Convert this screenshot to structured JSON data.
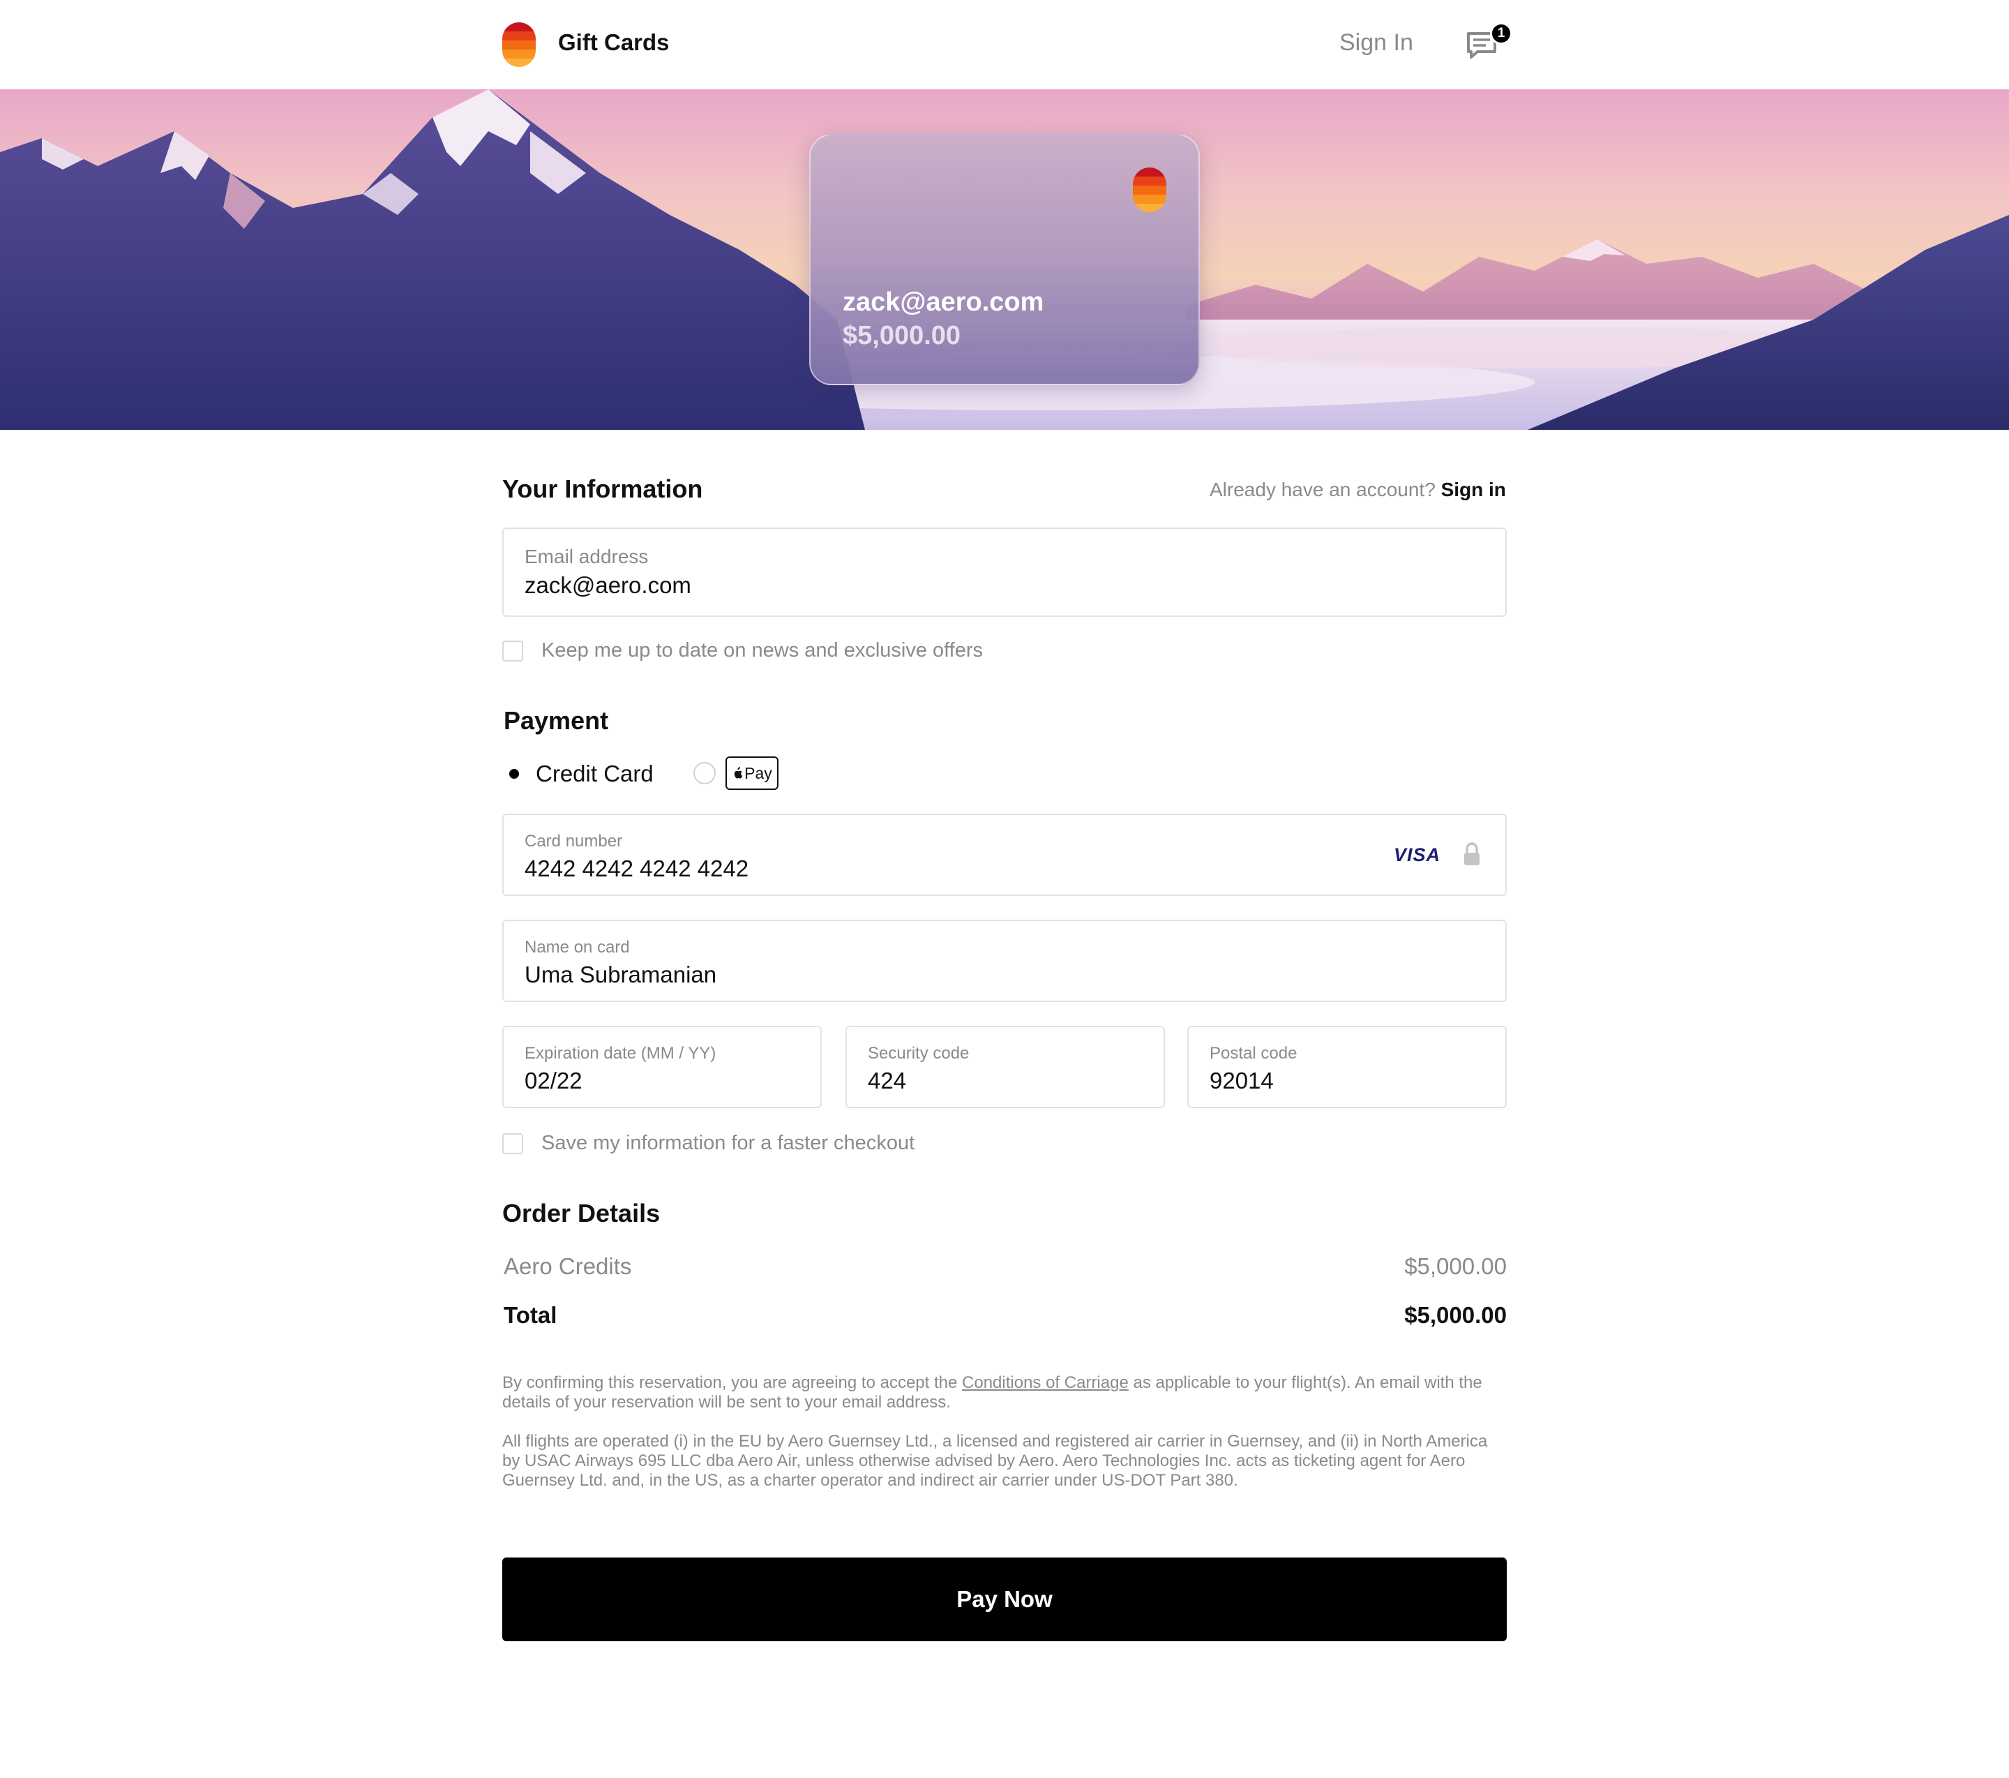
{
  "header": {
    "brand": "Gift Cards",
    "sign_in": "Sign In",
    "messages_icon": "chat-icon",
    "notification_count": "1"
  },
  "gift_card": {
    "email": "zack@aero.com",
    "amount": "$5,000.00"
  },
  "your_information": {
    "title": "Your Information",
    "account_prompt": "Already have an account?",
    "sign_in_link": "Sign in",
    "email_label": "Email address",
    "email_value": "zack@aero.com",
    "newsletter_label": "Keep me up to date on news and exclusive offers"
  },
  "payment": {
    "title": "Payment",
    "method_credit": "Credit Card",
    "method_applepay": "Pay",
    "selected": "Credit Card",
    "card_number_label": "Card number",
    "card_number_value": "4242 4242 4242 4242",
    "card_brand": "VISA",
    "name_label": "Name on card",
    "name_value": "Uma Subramanian",
    "expiry_label": "Expiration date (MM / YY)",
    "expiry_value": "02/22",
    "security_label": "Security code",
    "security_value": "424",
    "postal_label": "Postal code",
    "postal_value": "92014",
    "save_label": "Save my information for a faster checkout"
  },
  "order": {
    "title": "Order Details",
    "item_label": "Aero Credits",
    "item_price": "$5,000.00",
    "total_label": "Total",
    "total_price": "$5,000.00"
  },
  "legal": {
    "p1_before": "By confirming this reservation, you are agreeing to accept the ",
    "p1_link": "Conditions of Carriage",
    "p1_after": " as applicable to your flight(s). An email with the details of your reservation will be sent to your email address.",
    "p2": "All flights are operated (i) in the EU by Aero Guernsey Ltd., a licensed and registered air carrier in Guernsey, and (ii) in North America by USAC Airways 695 LLC dba Aero Air, unless otherwise advised by Aero. Aero Technologies Inc. acts as ticketing agent for Aero Guernsey Ltd. and, in the US, as a charter operator and indirect air carrier under US-DOT Part 380."
  },
  "cta": {
    "pay_now": "Pay Now"
  },
  "colors": {
    "logo_stripes": [
      "#c4161c",
      "#e8411a",
      "#f26a12",
      "#f7931e",
      "#fbb03b"
    ],
    "primary_button": "#000000",
    "muted_text": "#8a8a8a"
  }
}
